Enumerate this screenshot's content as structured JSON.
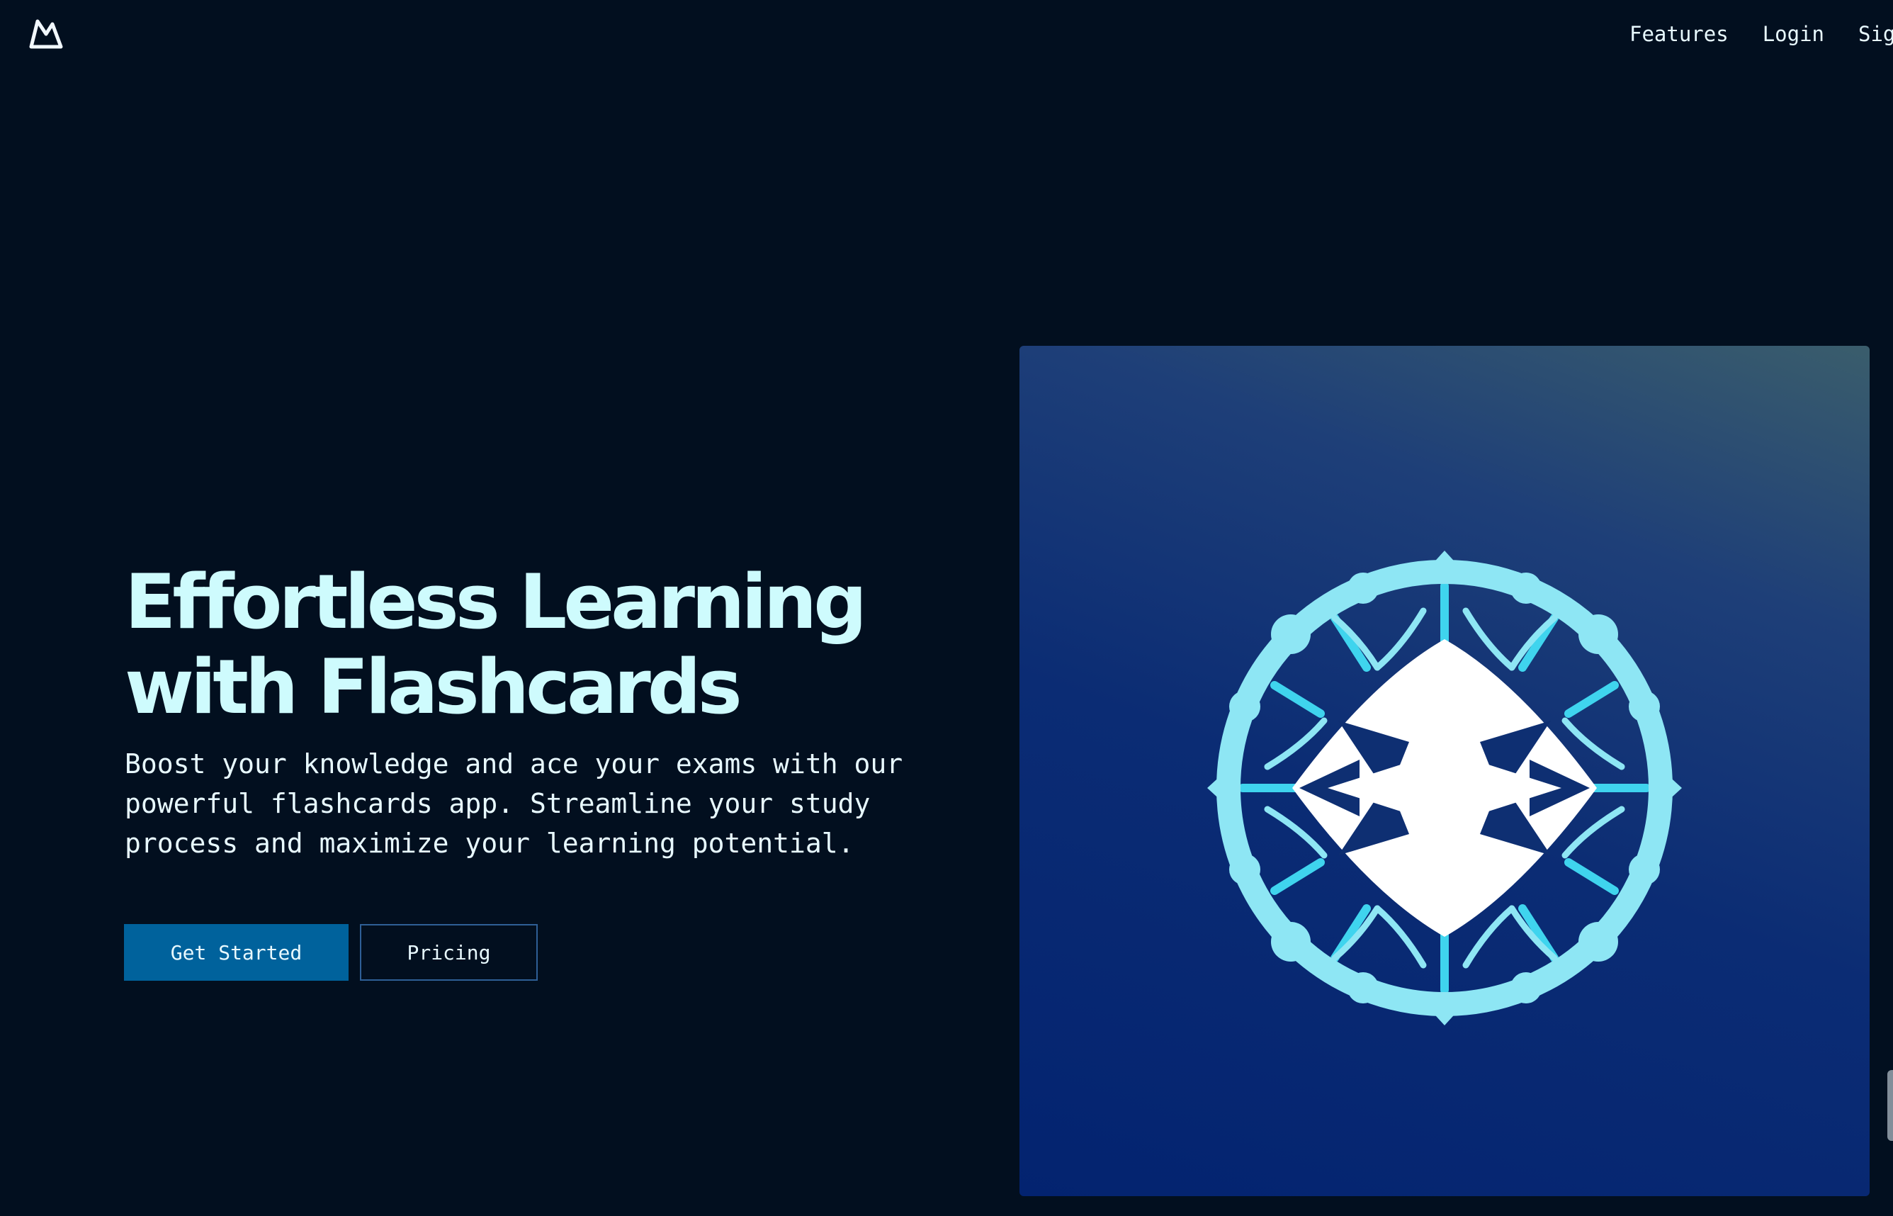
{
  "nav": {
    "logo_icon": "mountain-logo-icon",
    "items": [
      "Features",
      "Login",
      "Sign Up"
    ]
  },
  "hero": {
    "title_line1": "Effortless Learning",
    "title_line2": "with Flashcards",
    "subtitle": "Boost your knowledge and ace your exams with our powerful flashcards app. Streamline your study process and maximize your learning potential.",
    "primary_button": "Get Started",
    "secondary_button": "Pricing",
    "image_icon": "compass-star-emblem-icon"
  },
  "colors": {
    "background": "#020f1f",
    "title": "#cefbfd",
    "primary_button": "#00629c",
    "secondary_border": "#2f5f96",
    "emblem_ring": "#8ee6f4",
    "emblem_accent": "#3fd4ee"
  }
}
